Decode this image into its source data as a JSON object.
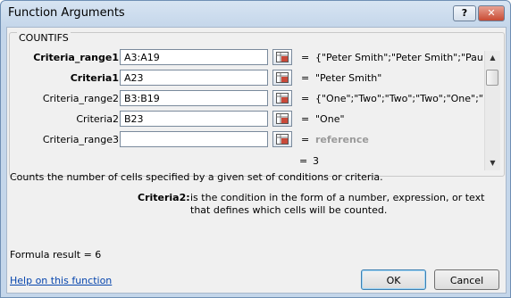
{
  "window": {
    "title": "Function Arguments",
    "help_button": "?",
    "close_button": "✕"
  },
  "function_name": "COUNTIFS",
  "arguments": [
    {
      "label": "Criteria_range1",
      "bold": true,
      "input": "A3:A19",
      "value": "{\"Peter Smith\";\"Peter Smith\";\"Paul ..."
    },
    {
      "label": "Criteria1",
      "bold": true,
      "input": "A23",
      "value": "\"Peter Smith\""
    },
    {
      "label": "Criteria_range2",
      "bold": false,
      "input": "B3:B19",
      "value": "{\"One\";\"Two\";\"Two\";\"Two\";\"One\";\"Tw"
    },
    {
      "label": "Criteria2",
      "bold": false,
      "input": "B23",
      "value": "\"One\""
    },
    {
      "label": "Criteria_range3",
      "bold": false,
      "input": "",
      "value": "reference"
    }
  ],
  "result": {
    "equals": "=",
    "value": "3"
  },
  "description": "Counts the number of cells specified by a given set of conditions or criteria.",
  "argument_help": {
    "name": "Criteria2:",
    "text": "is the condition in the form of a number, expression, or text that defines which cells will be counted."
  },
  "formula_result": "Formula result =   6",
  "help_link": "Help on this function",
  "buttons": {
    "ok": "OK",
    "cancel": "Cancel"
  }
}
